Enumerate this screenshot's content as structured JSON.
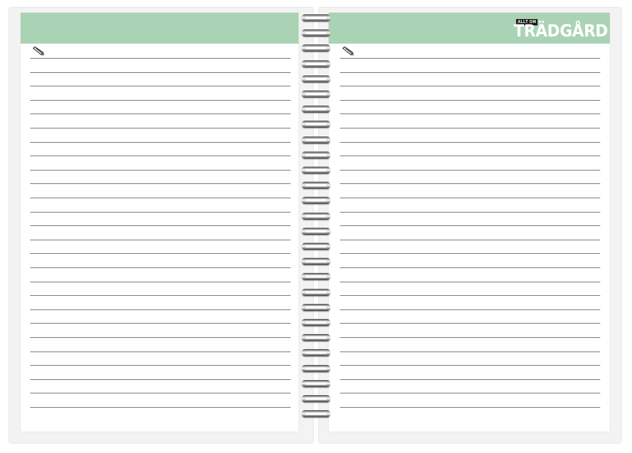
{
  "brand": {
    "kicker": "ALLT OM",
    "title": "TRÄDGÅRD",
    "band_color": "#aad3b5"
  },
  "pages": [
    {
      "side": "left",
      "icon": "pencil-icon",
      "ruled_lines": 26
    },
    {
      "side": "right",
      "icon": "pencil-icon",
      "ruled_lines": 26
    }
  ],
  "spiral": {
    "rings": 27
  }
}
